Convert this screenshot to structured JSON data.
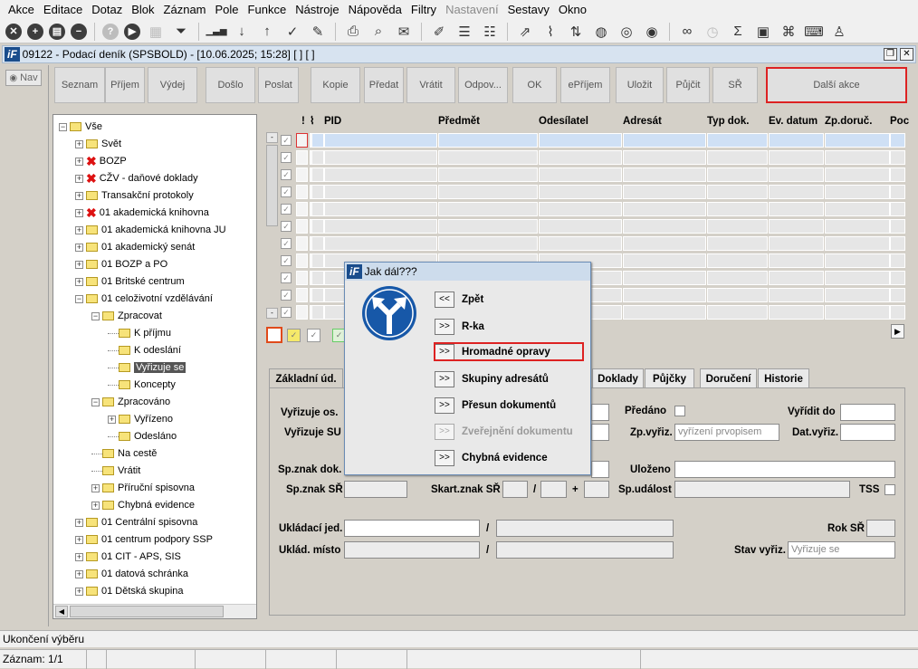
{
  "menubar": {
    "items": [
      {
        "label": "Akce",
        "enabled": true
      },
      {
        "label": "Editace",
        "enabled": true
      },
      {
        "label": "Dotaz",
        "enabled": true
      },
      {
        "label": "Blok",
        "enabled": true
      },
      {
        "label": "Záznam",
        "enabled": true
      },
      {
        "label": "Pole",
        "enabled": true
      },
      {
        "label": "Funkce",
        "enabled": true
      },
      {
        "label": "Nástroje",
        "enabled": true
      },
      {
        "label": "Nápověda",
        "enabled": true
      },
      {
        "label": "Filtry",
        "enabled": true
      },
      {
        "label": "Nastavení",
        "enabled": false
      },
      {
        "label": "Sestavy",
        "enabled": true
      },
      {
        "label": "Okno",
        "enabled": true
      }
    ]
  },
  "toolbar": {
    "icons": [
      "close-icon",
      "add-icon",
      "save-icon",
      "remove-icon",
      "help-icon",
      "run-icon",
      "calendar-icon",
      "filter-icon",
      "signal-icon",
      "sort-desc-icon",
      "sort-asc-icon",
      "check-icon",
      "wrench-icon",
      "print-icon",
      "print-preview-icon",
      "mail-icon",
      "edit-icon",
      "list-icon",
      "checklist-icon",
      "external-link-icon",
      "attach-icon",
      "signpost-icon",
      "globe-icon",
      "compass-icon",
      "eye-icon",
      "glasses-icon",
      "clock-icon",
      "sigma-icon",
      "excel-icon",
      "code-file-icon",
      "keyboard-icon",
      "user-icon"
    ]
  },
  "window": {
    "logo": "iF",
    "title": "09122 - Podací deník (SPSBOLD) - [10.06.2025; 15:28]  [ ]  [ ]"
  },
  "nav": {
    "label": "Nav"
  },
  "actions": [
    "Seznam",
    "Příjem",
    "Výdej",
    "Došlo",
    "Poslat",
    "Kopie",
    "Předat",
    "Vrátit",
    "Odpov...",
    "OK",
    "ePříjem",
    "Uložit",
    "Půjčit",
    "SŘ",
    "Další akce"
  ],
  "tree": {
    "nodes": [
      {
        "label": "Vše",
        "level": 0,
        "mark": "minus",
        "x": false
      },
      {
        "label": "Svět",
        "level": 1,
        "mark": "plus",
        "x": false
      },
      {
        "label": "BOZP",
        "level": 1,
        "mark": "plus",
        "x": true
      },
      {
        "label": "CŽV - daňové doklady",
        "level": 1,
        "mark": "plus",
        "x": true
      },
      {
        "label": "Transakční protokoly",
        "level": 1,
        "mark": "plus",
        "x": false
      },
      {
        "label": "01 akademická knihovna",
        "level": 1,
        "mark": "plus",
        "x": true
      },
      {
        "label": "01 akademická knihovna JU",
        "level": 1,
        "mark": "plus",
        "x": false
      },
      {
        "label": "01 akademický senát",
        "level": 1,
        "mark": "plus",
        "x": false
      },
      {
        "label": "01 BOZP a PO",
        "level": 1,
        "mark": "plus",
        "x": false
      },
      {
        "label": "01 Britské centrum",
        "level": 1,
        "mark": "plus",
        "x": false
      },
      {
        "label": "01 celoživotní vzdělávání",
        "level": 1,
        "mark": "minus",
        "x": false
      },
      {
        "label": "Zpracovat",
        "level": 2,
        "mark": "minus",
        "x": false
      },
      {
        "label": "K příjmu",
        "level": 3,
        "mark": "none",
        "x": false
      },
      {
        "label": "K odeslání",
        "level": 3,
        "mark": "none",
        "x": false
      },
      {
        "label": "Vyřizuje se",
        "level": 3,
        "mark": "none",
        "x": false,
        "selected": true
      },
      {
        "label": "Koncepty",
        "level": 3,
        "mark": "none",
        "x": false
      },
      {
        "label": "Zpracováno",
        "level": 2,
        "mark": "minus",
        "x": false
      },
      {
        "label": "Vyřízeno",
        "level": 3,
        "mark": "plus",
        "x": false
      },
      {
        "label": "Odesláno",
        "level": 3,
        "mark": "none",
        "x": false
      },
      {
        "label": "Na cestě",
        "level": 2,
        "mark": "none",
        "x": false
      },
      {
        "label": "Vrátit",
        "level": 2,
        "mark": "none",
        "x": false
      },
      {
        "label": "Příruční spisovna",
        "level": 2,
        "mark": "plus",
        "x": false
      },
      {
        "label": "Chybná evidence",
        "level": 2,
        "mark": "plus",
        "x": false
      },
      {
        "label": "01 Centrální spisovna",
        "level": 1,
        "mark": "plus",
        "x": false
      },
      {
        "label": "01 centrum podpory SSP",
        "level": 1,
        "mark": "plus",
        "x": false
      },
      {
        "label": "01 CIT - APS, SIS",
        "level": 1,
        "mark": "plus",
        "x": false
      },
      {
        "label": "01 datová schránka",
        "level": 1,
        "mark": "plus",
        "x": false
      },
      {
        "label": "01 Dětská skupina",
        "level": 1,
        "mark": "plus",
        "x": false
      }
    ]
  },
  "grid": {
    "headers": [
      "!",
      "PID",
      "Předmět",
      "Odesílatel",
      "Adresát",
      "Typ dok.",
      "Ev. datum",
      "Zp.doruč.",
      "Poc"
    ],
    "row_count": 11
  },
  "tabs": [
    "Základní úd.",
    "Doklady",
    "Půjčky",
    "Doručení",
    "Historie"
  ],
  "form": {
    "vyrizuje_os": "Vyřizuje os.",
    "vyrizuje_su": "Vyřizuje SU",
    "predano": "Předáno",
    "vyridit_do": "Vyřídit do",
    "zp_vyriz": "Zp.vyřiz.",
    "zp_vyriz_value": "vyřízení prvopisem",
    "dat_vyriz": "Dat.vyřiz.",
    "sp_znak_dok": "Sp.znak dok.",
    "ulozeno": "Uloženo",
    "sp_znak_sr": "Sp.znak SŘ",
    "skart_znak_sr": "Skart.znak SŘ",
    "slash": "/",
    "plus": "+",
    "sp_udalost": "Sp.událost",
    "tss": "TSS",
    "ukladaci_jed": "Ukládací jed.",
    "rok_sr": "Rok SŘ",
    "uklad_misto": "Uklád. místo",
    "stav_vyriz": "Stav vyřiz.",
    "stav_vyriz_value": "Vyřizuje se"
  },
  "dialog": {
    "logo": "iF",
    "title": "Jak dál???",
    "items": [
      {
        "button": "<<",
        "label": "Zpět",
        "enabled": true
      },
      {
        "button": ">>",
        "label": "R-ka",
        "enabled": true
      },
      {
        "button": ">>",
        "label": "Hromadné opravy",
        "enabled": true
      },
      {
        "button": ">>",
        "label": "Skupiny adresátů",
        "enabled": true
      },
      {
        "button": ">>",
        "label": "Přesun dokumentů",
        "enabled": true
      },
      {
        "button": ">>",
        "label": "Zveřejnění dokumentu",
        "enabled": false
      },
      {
        "button": ">>",
        "label": "Chybná evidence",
        "enabled": true
      }
    ]
  },
  "status": {
    "message": "Ukončení výběru",
    "record": "Záznam: 1/1"
  },
  "colors": {
    "highlight_red": "#dd2222",
    "title_blue": "#1a4d8c"
  }
}
